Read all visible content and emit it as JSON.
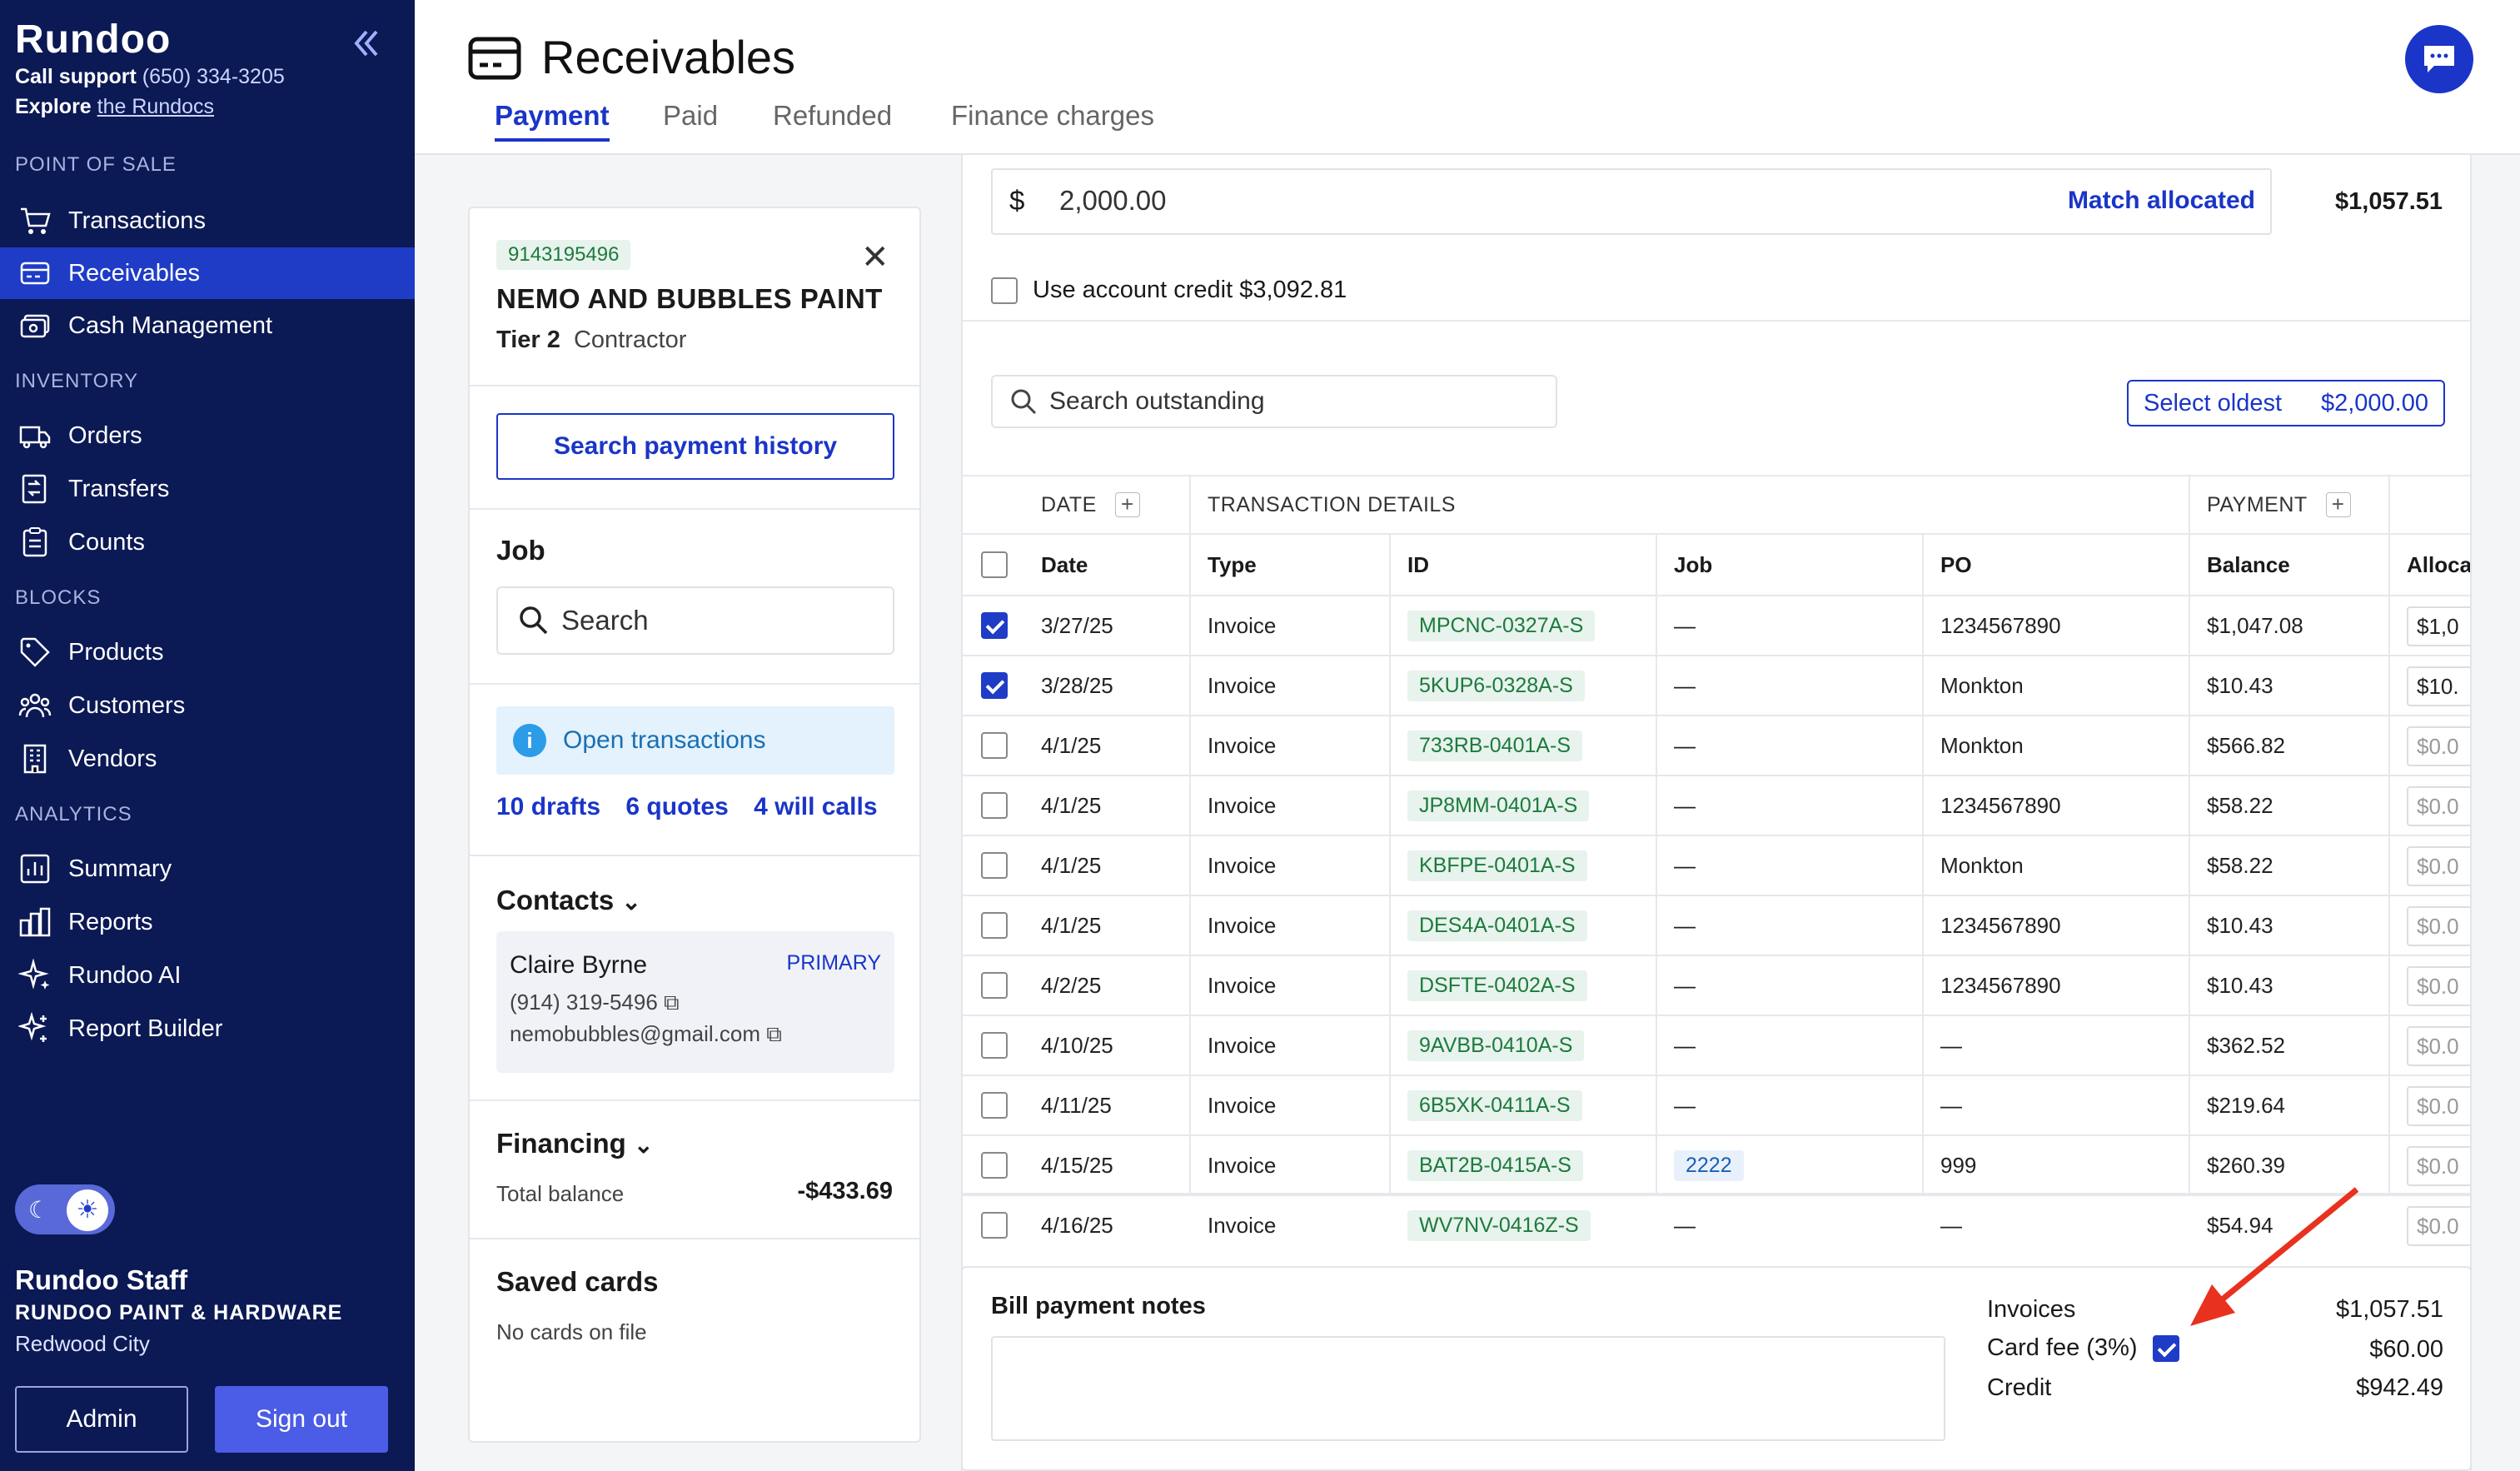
{
  "sidebar": {
    "logo": "Rundoo",
    "support_label": "Call support",
    "support_phone": "(650) 334-3205",
    "explore_label": "Explore",
    "explore_link": "the Rundocs",
    "sections": {
      "pos": "POINT OF SALE",
      "inventory": "INVENTORY",
      "blocks": "BLOCKS",
      "analytics": "ANALYTICS"
    },
    "items": [
      {
        "label": "Transactions",
        "icon": "cart-icon"
      },
      {
        "label": "Receivables",
        "icon": "receivables-icon",
        "active": true
      },
      {
        "label": "Cash Management",
        "icon": "cash-icon"
      },
      {
        "label": "Orders",
        "icon": "truck-icon"
      },
      {
        "label": "Transfers",
        "icon": "transfer-icon"
      },
      {
        "label": "Counts",
        "icon": "clipboard-icon"
      },
      {
        "label": "Products",
        "icon": "tag-icon"
      },
      {
        "label": "Customers",
        "icon": "people-icon"
      },
      {
        "label": "Vendors",
        "icon": "building-icon"
      },
      {
        "label": "Summary",
        "icon": "chart-icon"
      },
      {
        "label": "Reports",
        "icon": "reports-icon"
      },
      {
        "label": "Rundoo AI",
        "icon": "sparkle-icon"
      },
      {
        "label": "Report Builder",
        "icon": "builder-icon"
      }
    ],
    "user": {
      "name": "Rundoo Staff",
      "store": "RUNDOO PAINT & HARDWARE",
      "city": "Redwood City"
    },
    "admin_label": "Admin",
    "signout_label": "Sign out"
  },
  "header": {
    "title": "Receivables",
    "tabs": [
      "Payment",
      "Paid",
      "Refunded",
      "Finance charges"
    ],
    "active_tab": "Payment"
  },
  "customer": {
    "account_id": "9143195496",
    "name": "NEMO AND BUBBLES PAINT",
    "tier": "Tier 2",
    "type": "Contractor",
    "search_history_label": "Search payment history",
    "job_label": "Job",
    "job_placeholder": "Search",
    "open_tx_label": "Open transactions",
    "links": [
      "10 drafts",
      "6 quotes",
      "4 will calls"
    ],
    "contacts_label": "Contacts",
    "contact": {
      "name": "Claire Byrne",
      "badge": "PRIMARY",
      "phone": "(914) 319-5496",
      "email": "nemobubbles@gmail.com"
    },
    "financing_label": "Financing",
    "total_balance_label": "Total balance",
    "total_balance": "-$433.69",
    "saved_cards_label": "Saved cards",
    "no_cards": "No cards on file"
  },
  "payment": {
    "currency": "$",
    "amount": "2,000.00",
    "match_label": "Match allocated",
    "allocated_total": "$1,057.51",
    "use_credit_label": "Use account credit $3,092.81",
    "search_placeholder": "Search outstanding",
    "select_oldest_label": "Select oldest",
    "select_oldest_amount": "$2,000.00"
  },
  "table": {
    "groups": [
      "DATE",
      "TRANSACTION DETAILS",
      "PAYMENT"
    ],
    "columns": [
      "Date",
      "Type",
      "ID",
      "Job",
      "PO",
      "Balance",
      "Allocat"
    ],
    "rows": [
      {
        "date": "3/27/25",
        "type": "Invoice",
        "id": "MPCNC-0327A-S",
        "job": "—",
        "po": "1234567890",
        "balance": "$1,047.08",
        "alloc": "$1,0",
        "checked": true
      },
      {
        "date": "3/28/25",
        "type": "Invoice",
        "id": "5KUP6-0328A-S",
        "job": "—",
        "po": "Monkton",
        "balance": "$10.43",
        "alloc": "$10.",
        "checked": true
      },
      {
        "date": "4/1/25",
        "type": "Invoice",
        "id": "733RB-0401A-S",
        "job": "—",
        "po": "Monkton",
        "balance": "$566.82",
        "alloc": "$0.0",
        "checked": false
      },
      {
        "date": "4/1/25",
        "type": "Invoice",
        "id": "JP8MM-0401A-S",
        "job": "—",
        "po": "1234567890",
        "balance": "$58.22",
        "alloc": "$0.0",
        "checked": false
      },
      {
        "date": "4/1/25",
        "type": "Invoice",
        "id": "KBFPE-0401A-S",
        "job": "—",
        "po": "Monkton",
        "balance": "$58.22",
        "alloc": "$0.0",
        "checked": false
      },
      {
        "date": "4/1/25",
        "type": "Invoice",
        "id": "DES4A-0401A-S",
        "job": "—",
        "po": "1234567890",
        "balance": "$10.43",
        "alloc": "$0.0",
        "checked": false
      },
      {
        "date": "4/2/25",
        "type": "Invoice",
        "id": "DSFTE-0402A-S",
        "job": "—",
        "po": "1234567890",
        "balance": "$10.43",
        "alloc": "$0.0",
        "checked": false
      },
      {
        "date": "4/10/25",
        "type": "Invoice",
        "id": "9AVBB-0410A-S",
        "job": "—",
        "po": "—",
        "balance": "$362.52",
        "alloc": "$0.0",
        "checked": false
      },
      {
        "date": "4/11/25",
        "type": "Invoice",
        "id": "6B5XK-0411A-S",
        "job": "—",
        "po": "—",
        "balance": "$219.64",
        "alloc": "$0.0",
        "checked": false
      },
      {
        "date": "4/15/25",
        "type": "Invoice",
        "id": "BAT2B-0415A-S",
        "job": "2222",
        "po": "999",
        "balance": "$260.39",
        "alloc": "$0.0",
        "checked": false
      },
      {
        "date": "4/16/25",
        "type": "Invoice",
        "id": "WV7NV-0416Z-S",
        "job": "—",
        "po": "—",
        "balance": "$54.94",
        "alloc": "$0.0",
        "checked": false
      }
    ]
  },
  "summary": {
    "notes_label": "Bill payment notes",
    "invoices_label": "Invoices",
    "invoices_value": "$1,057.51",
    "card_fee_label": "Card fee (3%)",
    "card_fee_value": "$60.00",
    "credit_label": "Credit",
    "credit_value": "$942.49"
  },
  "colors": {
    "sidebar_bg": "#0b1954",
    "accent": "#1a35c8",
    "annotation_arrow": "#e8321e"
  }
}
